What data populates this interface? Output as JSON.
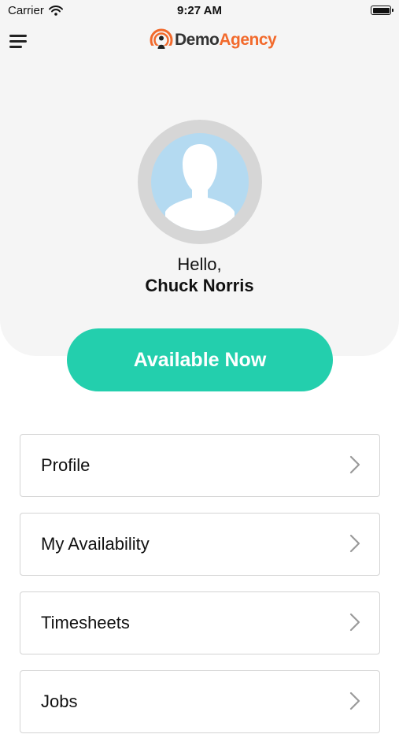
{
  "status_bar": {
    "carrier": "Carrier",
    "time": "9:27 AM",
    "wifi_icon": "wifi-icon",
    "battery_icon": "battery-icon"
  },
  "header": {
    "menu_icon": "hamburger-menu-icon",
    "brand": {
      "word1": "Demo",
      "word2": "Agency",
      "logo_icon": "broadcast-person-icon"
    }
  },
  "profile": {
    "avatar_icon": "user-silhouette-icon",
    "greeting": "Hello,",
    "name": "Chuck Norris"
  },
  "status_button": {
    "label": "Available Now"
  },
  "menu": {
    "items": [
      {
        "label": "Profile"
      },
      {
        "label": "My Availability"
      },
      {
        "label": "Timesheets"
      },
      {
        "label": "Jobs"
      }
    ],
    "chevron_icon": "chevron-right-icon"
  },
  "colors": {
    "accent": "#23cfad",
    "brand_orange": "#f26a2c",
    "header_background": "#f5f5f5",
    "avatar_ring": "#d6d6d6",
    "avatar_fill": "#b4daf1"
  }
}
